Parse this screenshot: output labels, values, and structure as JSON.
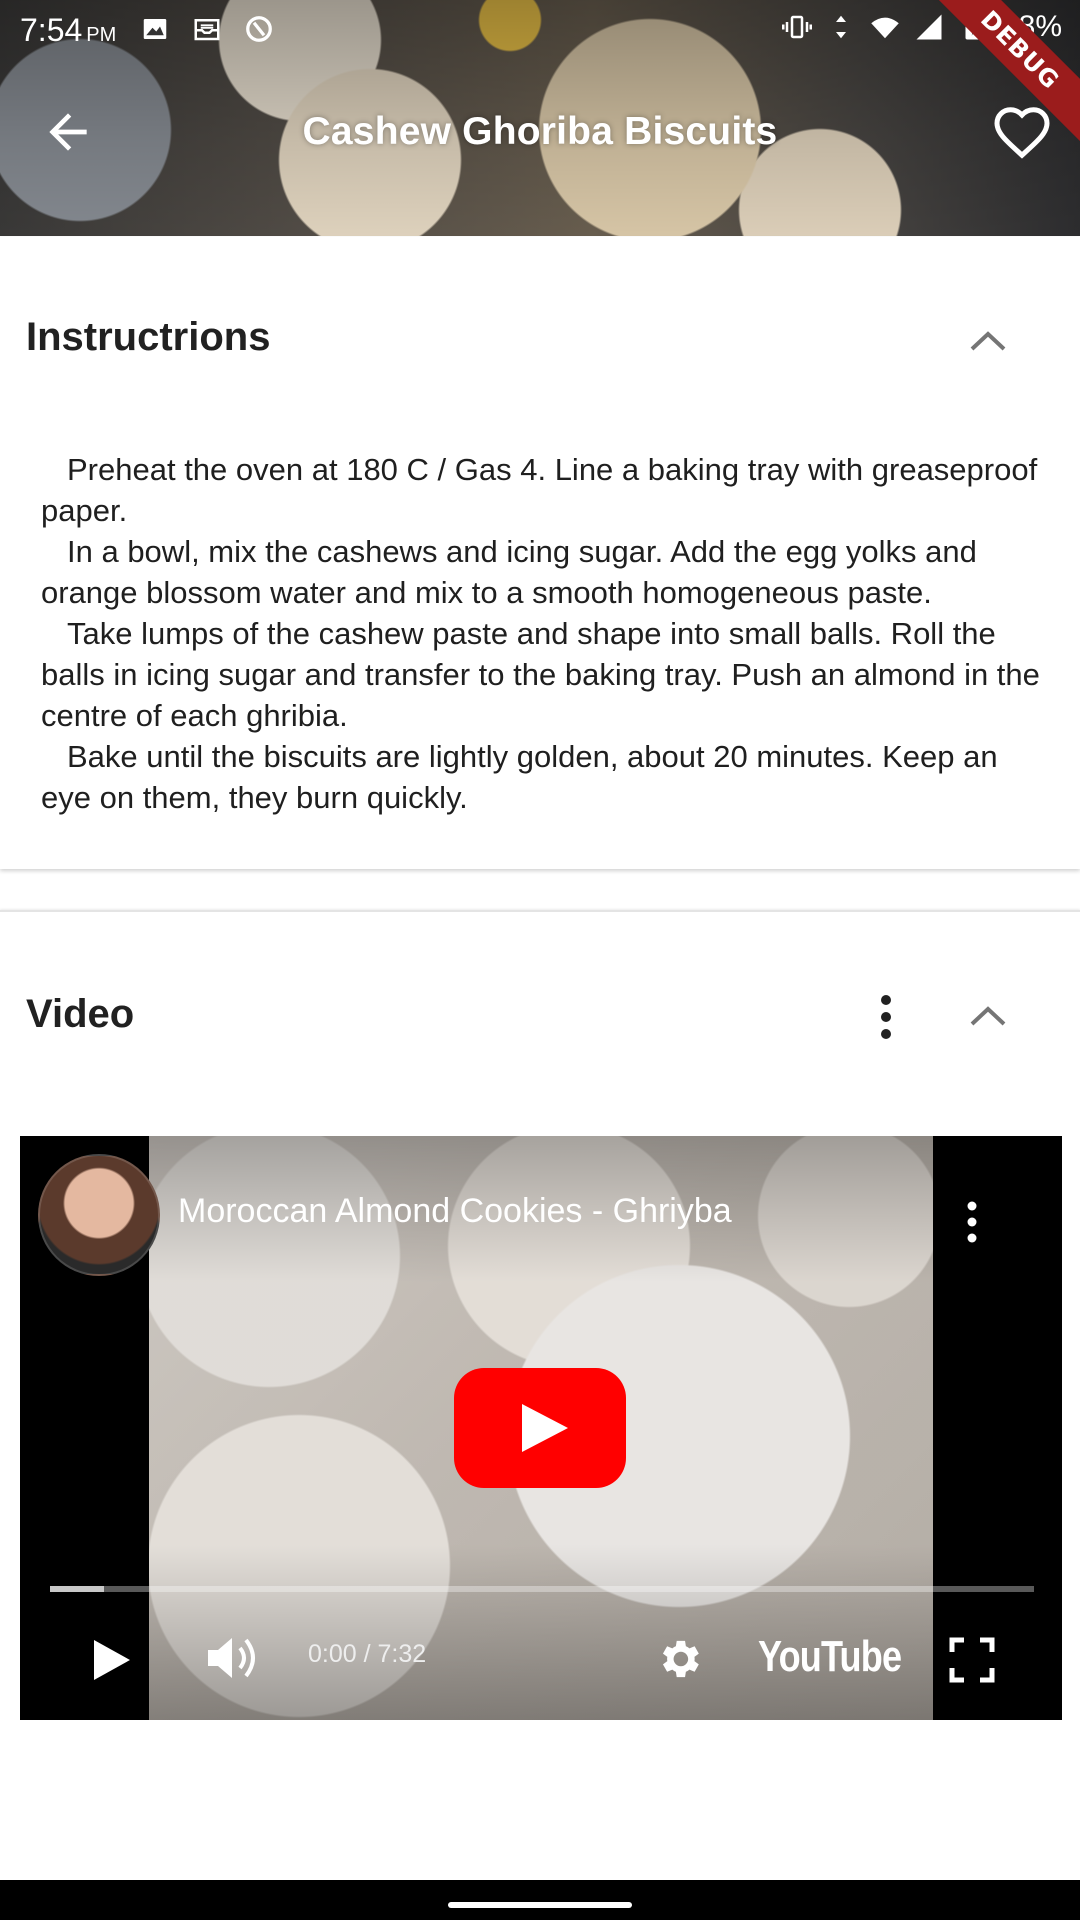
{
  "status_bar": {
    "time": "7:54",
    "ampm": "PM",
    "battery": "98%"
  },
  "app_bar": {
    "title": "Cashew Ghoriba Biscuits",
    "debug_label": "DEBUG"
  },
  "instructions": {
    "heading": "Instructrions",
    "paragraphs": [
      "Preheat the oven at 180 C / Gas 4. Line a baking tray with greaseproof paper.",
      "In a bowl, mix the cashews and icing sugar. Add the egg yolks and orange blossom water and mix to a smooth homogeneous paste.",
      "Take lumps of the cashew paste and shape into small balls. Roll the balls in icing sugar and transfer to the baking tray. Push an almond in the centre of each ghribia.",
      "Bake until the biscuits are lightly golden, about 20 minutes. Keep an eye on them, they burn quickly."
    ]
  },
  "video": {
    "heading": "Video",
    "player": {
      "title": "Moroccan Almond Cookies - Ghriyba",
      "time": "0:00 / 7:32",
      "brand": "YouTube",
      "progress_buffered_fraction": 0.055
    }
  },
  "colors": {
    "youtube_red": "#ff0000",
    "debug_red": "#9b1c1c"
  }
}
